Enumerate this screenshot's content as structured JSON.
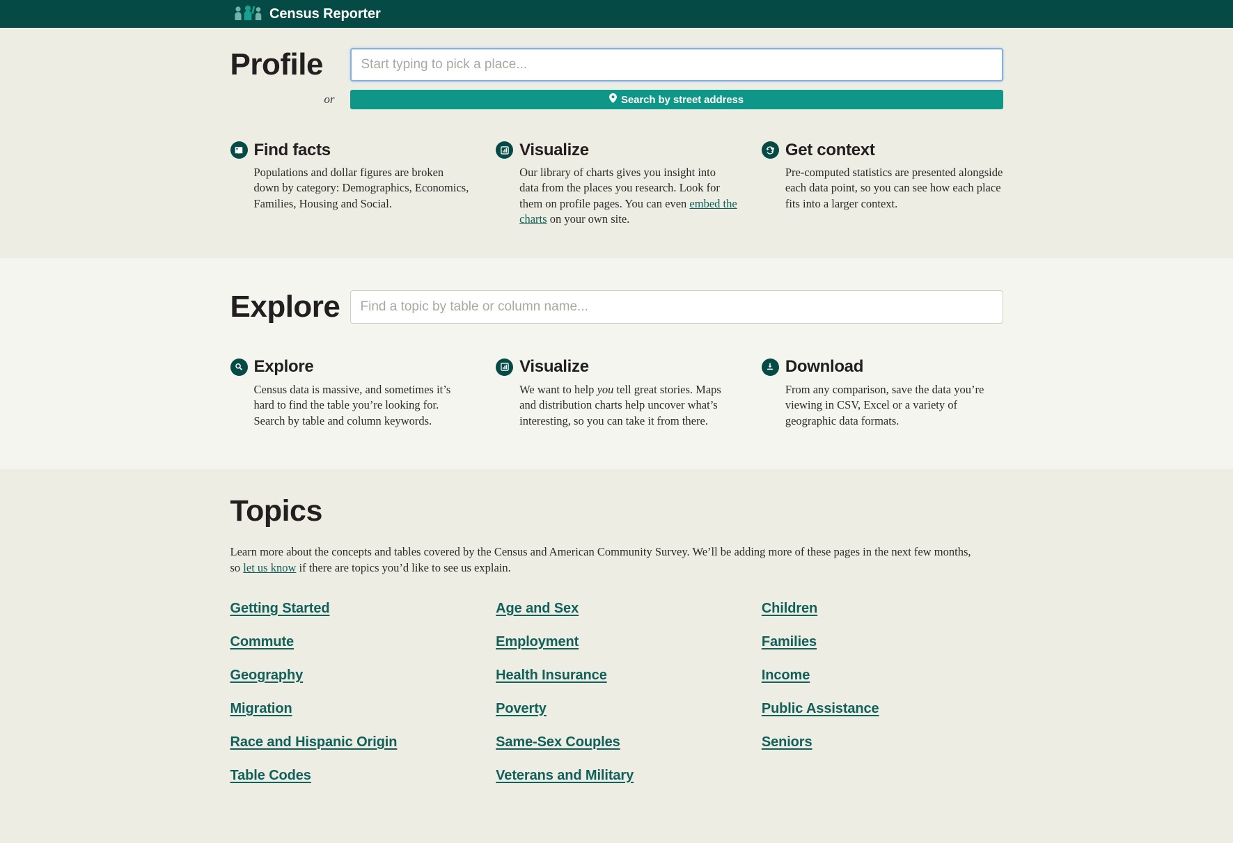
{
  "colors": {
    "header_bg": "#064A46",
    "accent_teal": "#0E9688",
    "link_teal": "#11605A",
    "icon_circle": "#064A46",
    "profile_bg": "#EDEDE4",
    "explore_bg": "#F5F5F0",
    "topics_bg": "#EDEDE4",
    "heading": "#231F20"
  },
  "header": {
    "brand_name": "Census Reporter",
    "logo_icon": "three-people-icon"
  },
  "profile": {
    "title": "Profile",
    "search_placeholder": "Start typing to pick a place...",
    "search_value": "",
    "or_label": "or",
    "street_button_label": "Search by street address",
    "street_button_icon": "map-pin-icon",
    "cards": [
      {
        "icon": "book-icon",
        "title": "Find facts",
        "body": "Populations and dollar figures are broken down by category: Demographics, Economics, Families, Housing and Social."
      },
      {
        "icon": "bar-chart-icon",
        "title": "Visualize",
        "body_before_link": "Our library of charts gives you insight into data from the places you research. Look for them on profile pages. You can even ",
        "link_text": "embed the charts",
        "body_after_link": " on your own site."
      },
      {
        "icon": "refresh-icon",
        "title": "Get context",
        "body": "Pre-computed statistics are presented alongside each data point, so you can see how each place fits into a larger context."
      }
    ]
  },
  "explore": {
    "title": "Explore",
    "search_placeholder": "Find a topic by table or column name...",
    "search_value": "",
    "cards": [
      {
        "icon": "search-icon",
        "title": "Explore",
        "body": "Census data is massive, and sometimes it’s hard to find the table you’re looking for. Search by table and column keywords."
      },
      {
        "icon": "bar-chart-icon",
        "title": "Visualize",
        "body_before_em": "We want to help ",
        "em_text": "you",
        "body_after_em": " tell great stories. Maps and distribution charts help uncover what’s interesting, so you can take it from there."
      },
      {
        "icon": "download-icon",
        "title": "Download",
        "body": "From any comparison, save the data you’re viewing in CSV, Excel or a variety of geographic data formats."
      }
    ]
  },
  "topics": {
    "title": "Topics",
    "intro_before_link": "Learn more about the concepts and tables covered by the Census and American Community Survey. We’ll be adding more of these pages in the next few months, so ",
    "intro_link": "let us know",
    "intro_after_link": " if there are topics you’d like to see us explain.",
    "columns": [
      [
        "Getting Started",
        "Commute",
        "Geography",
        "Migration",
        "Race and Hispanic Origin",
        "Table Codes"
      ],
      [
        "Age and Sex",
        "Employment",
        "Health Insurance",
        "Poverty",
        "Same-Sex Couples",
        "Veterans and Military"
      ],
      [
        "Children",
        "Families",
        "Income",
        "Public Assistance",
        "Seniors"
      ]
    ]
  }
}
